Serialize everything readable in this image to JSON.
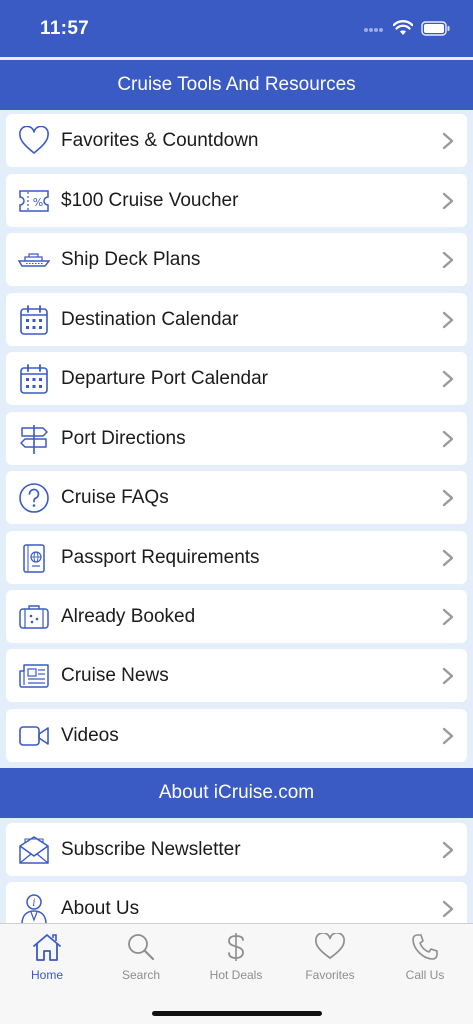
{
  "status_bar": {
    "time": "11:57"
  },
  "sections": [
    {
      "title": "Cruise Tools And Resources",
      "items": [
        {
          "label": "Favorites & Countdown",
          "icon": "heart-icon"
        },
        {
          "label": "$100 Cruise Voucher",
          "icon": "voucher-icon"
        },
        {
          "label": "Ship Deck Plans",
          "icon": "ship-icon"
        },
        {
          "label": "Destination Calendar",
          "icon": "calendar-icon"
        },
        {
          "label": "Departure Port Calendar",
          "icon": "calendar-icon"
        },
        {
          "label": "Port Directions",
          "icon": "signpost-icon"
        },
        {
          "label": "Cruise FAQs",
          "icon": "question-icon"
        },
        {
          "label": "Passport Requirements",
          "icon": "passport-icon"
        },
        {
          "label": "Already Booked",
          "icon": "luggage-icon"
        },
        {
          "label": "Cruise News",
          "icon": "newspaper-icon"
        },
        {
          "label": "Videos",
          "icon": "video-icon"
        }
      ]
    },
    {
      "title": "About iCruise.com",
      "items": [
        {
          "label": "Subscribe Newsletter",
          "icon": "envelope-icon"
        },
        {
          "label": "About Us",
          "icon": "info-person-icon"
        }
      ]
    }
  ],
  "tab_bar": {
    "tabs": [
      {
        "label": "Home",
        "icon": "home-icon",
        "active": true
      },
      {
        "label": "Search",
        "icon": "search-icon",
        "active": false
      },
      {
        "label": "Hot Deals",
        "icon": "dollar-icon",
        "active": false
      },
      {
        "label": "Favorites",
        "icon": "heart-icon",
        "active": false
      },
      {
        "label": "Call Us",
        "icon": "phone-icon",
        "active": false
      }
    ]
  },
  "colors": {
    "brand_blue": "#3a5ac4",
    "background": "#e3eefa",
    "active_tab": "#3a5ac4",
    "inactive_tab": "#8e8e8e"
  }
}
